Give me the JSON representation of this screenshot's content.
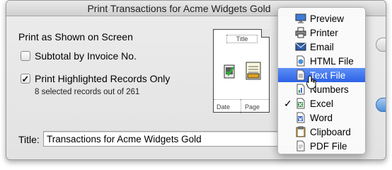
{
  "window": {
    "title": "Print Transactions for Acme Widgets Gold"
  },
  "options": {
    "heading": "Print as Shown on Screen",
    "subtotal_label": "Subtotal by Invoice No.",
    "subtotal_checked": false,
    "highlighted_label": "Print Highlighted Records Only",
    "highlighted_checked": true,
    "checkmark": "✓",
    "selection_note": "8 selected records out of 261"
  },
  "preview": {
    "title_placeholder": "Title",
    "date_placeholder": "Date",
    "page_placeholder": "Page"
  },
  "title_field": {
    "label": "Title:",
    "value": "Transactions for Acme Widgets Gold"
  },
  "menu": {
    "items": [
      {
        "label": "Preview",
        "icon": "monitor-icon",
        "selected": false,
        "checked": false
      },
      {
        "label": "Printer",
        "icon": "printer-icon",
        "selected": false,
        "checked": false
      },
      {
        "label": "Email",
        "icon": "envelope-icon",
        "selected": false,
        "checked": false
      },
      {
        "label": "HTML File",
        "icon": "html-file-icon",
        "selected": false,
        "checked": false
      },
      {
        "label": "Text File",
        "icon": "text-file-icon",
        "selected": true,
        "checked": false
      },
      {
        "label": "Numbers",
        "icon": "numbers-file-icon",
        "selected": false,
        "checked": false
      },
      {
        "label": "Excel",
        "icon": "excel-file-icon",
        "selected": false,
        "checked": true
      },
      {
        "label": "Word",
        "icon": "word-file-icon",
        "selected": false,
        "checked": false
      },
      {
        "label": "Clipboard",
        "icon": "clipboard-icon",
        "selected": false,
        "checked": false
      },
      {
        "label": "PDF File",
        "icon": "pdf-file-icon",
        "selected": false,
        "checked": false
      }
    ],
    "check_glyph": "✓"
  },
  "colors": {
    "selection": "#3a6fec",
    "accent": "#4f8fdb"
  }
}
